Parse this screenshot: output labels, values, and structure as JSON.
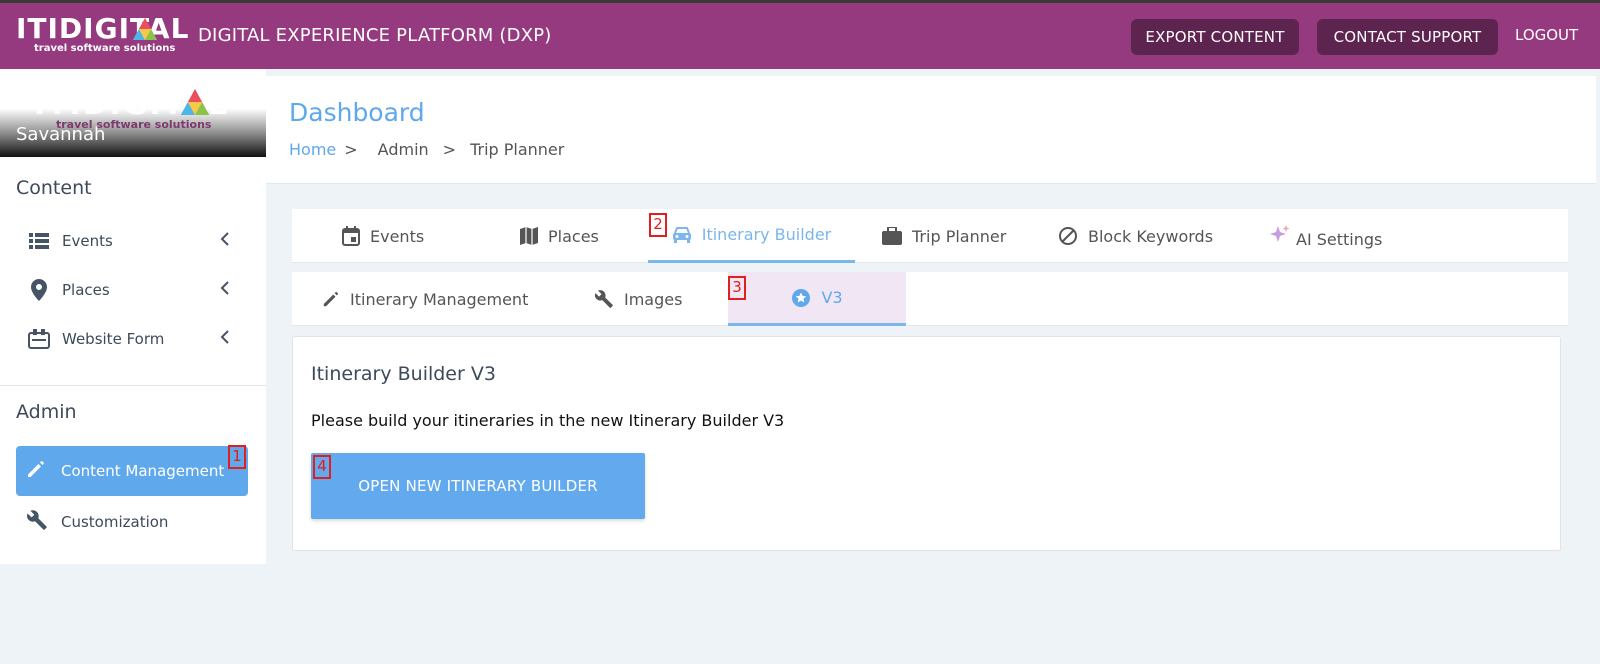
{
  "topbar": {
    "logo_text": "ITIDIGITAL",
    "logo_sub": "travel software solutions",
    "app_title": "DIGITAL EXPERIENCE PLATFORM (DXP)",
    "export_label": "EXPORT CONTENT",
    "support_label": "CONTACT SUPPORT",
    "logout_label": "LOGOUT",
    "color": "#963a7f",
    "button_color": "#5e2450"
  },
  "sidebar": {
    "logo_text": "ITIDIGITAL",
    "logo_sub": "travel software solutions",
    "user": "Savannah",
    "content_heading": "Content",
    "content_items": [
      {
        "label": "Events",
        "icon": "list-icon"
      },
      {
        "label": "Places",
        "icon": "map-pin-icon"
      },
      {
        "label": "Website Form",
        "icon": "form-icon"
      }
    ],
    "admin_heading": "Admin",
    "admin_items": [
      {
        "label": "Content Management",
        "icon": "pencil-icon",
        "active": true
      },
      {
        "label": "Customization",
        "icon": "wrench-icon"
      }
    ],
    "accent": "#5fa8ec"
  },
  "header": {
    "title": "Dashboard",
    "breadcrumb": [
      "Home",
      "Admin",
      "Trip Planner"
    ],
    "sep": ">"
  },
  "tabs_main": [
    {
      "label": "Events",
      "icon": "calendar-icon"
    },
    {
      "label": "Places",
      "icon": "map-icon"
    },
    {
      "label": "Itinerary Builder",
      "icon": "car-icon",
      "active": true
    },
    {
      "label": "Trip Planner",
      "icon": "briefcase-icon"
    },
    {
      "label": "Block Keywords",
      "icon": "block-icon"
    },
    {
      "label": "AI Settings",
      "icon": "sparkle-icon"
    }
  ],
  "tabs_sub": [
    {
      "label": "Itinerary Management",
      "icon": "pencil-icon"
    },
    {
      "label": "Images",
      "icon": "wrench-icon"
    },
    {
      "label": "V3",
      "icon": "star-circle-icon",
      "active": true
    }
  ],
  "card": {
    "title": "Itinerary Builder V3",
    "text": "Please build your itineraries in the new Itinerary Builder V3",
    "button_label": "OPEN NEW ITINERARY BUILDER"
  },
  "markers": [
    "1",
    "2",
    "3",
    "4"
  ]
}
